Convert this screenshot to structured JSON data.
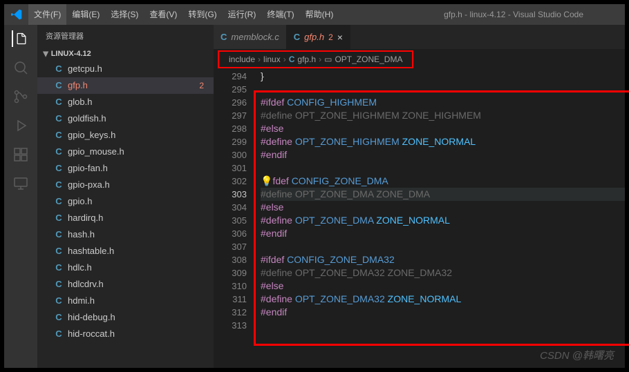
{
  "window": {
    "title": "gfp.h - linux-4.12 - Visual Studio Code"
  },
  "menu": [
    "文件(F)",
    "编辑(E)",
    "选择(S)",
    "查看(V)",
    "转到(G)",
    "运行(R)",
    "终端(T)",
    "帮助(H)"
  ],
  "sidebar": {
    "title": "资源管理器",
    "folder": "LINUX-4.12",
    "files": [
      {
        "lang": "C",
        "name": "getcpu.h"
      },
      {
        "lang": "C",
        "name": "gfp.h",
        "badge": "2",
        "selected": true
      },
      {
        "lang": "C",
        "name": "glob.h"
      },
      {
        "lang": "C",
        "name": "goldfish.h"
      },
      {
        "lang": "C",
        "name": "gpio_keys.h"
      },
      {
        "lang": "C",
        "name": "gpio_mouse.h"
      },
      {
        "lang": "C",
        "name": "gpio-fan.h"
      },
      {
        "lang": "C",
        "name": "gpio-pxa.h"
      },
      {
        "lang": "C",
        "name": "gpio.h"
      },
      {
        "lang": "C",
        "name": "hardirq.h"
      },
      {
        "lang": "C",
        "name": "hash.h"
      },
      {
        "lang": "C",
        "name": "hashtable.h"
      },
      {
        "lang": "C",
        "name": "hdlc.h"
      },
      {
        "lang": "C",
        "name": "hdlcdrv.h"
      },
      {
        "lang": "C",
        "name": "hdmi.h"
      },
      {
        "lang": "C",
        "name": "hid-debug.h"
      },
      {
        "lang": "C",
        "name": "hid-roccat.h"
      }
    ]
  },
  "tabs": [
    {
      "lang": "C",
      "name": "memblock.c",
      "active": false
    },
    {
      "lang": "C",
      "name": "gfp.h",
      "badge": "2",
      "active": true
    }
  ],
  "breadcrumb": {
    "parts": [
      "include",
      "linux"
    ],
    "fileLang": "C",
    "file": "gfp.h",
    "symbol": "OPT_ZONE_DMA"
  },
  "code": {
    "start": 294,
    "current": 303,
    "lines": [
      {
        "n": 294,
        "html": "<span class='tok-punc'>}</span>"
      },
      {
        "n": 295,
        "html": ""
      },
      {
        "n": 296,
        "html": "<span class='tok-dir'>#ifdef</span> <span class='tok-macro'>CONFIG_HIGHMEM</span>"
      },
      {
        "n": 297,
        "html": "<span class='tok-dim'>#define</span> <span class='tok-dim'>OPT_ZONE_HIGHMEM</span> <span class='tok-dim'>ZONE_HIGHMEM</span>"
      },
      {
        "n": 298,
        "html": "<span class='tok-dir'>#else</span>"
      },
      {
        "n": 299,
        "html": "<span class='tok-dir'>#define</span> <span class='tok-macro'>OPT_ZONE_HIGHMEM</span> <span class='tok-macro2'>ZONE_NORMAL</span>"
      },
      {
        "n": 300,
        "html": "<span class='tok-dir'>#endif</span>"
      },
      {
        "n": 301,
        "html": ""
      },
      {
        "n": 302,
        "html": "<span class='bulb'>💡</span><span class='tok-dir'>fdef</span> <span class='tok-macro'>CONFIG_ZONE_DMA</span>"
      },
      {
        "n": 303,
        "html": "<span class='tok-dim'>#define</span> <span class='tok-dim'>OPT_ZONE_DMA</span> <span class='tok-dim'>ZONE_DMA</span>",
        "hl": true
      },
      {
        "n": 304,
        "html": "<span class='tok-dir'>#else</span>"
      },
      {
        "n": 305,
        "html": "<span class='tok-dir'>#define</span> <span class='tok-macro'>OPT_ZONE_DMA</span> <span class='tok-macro2'>ZONE_NORMAL</span>"
      },
      {
        "n": 306,
        "html": "<span class='tok-dir'>#endif</span>"
      },
      {
        "n": 307,
        "html": ""
      },
      {
        "n": 308,
        "html": "<span class='tok-dir'>#ifdef</span> <span class='tok-macro'>CONFIG_ZONE_DMA32</span>"
      },
      {
        "n": 309,
        "html": "<span class='tok-dim'>#define</span> <span class='tok-dim'>OPT_ZONE_DMA32</span> <span class='tok-dim'>ZONE_DMA32</span>"
      },
      {
        "n": 310,
        "html": "<span class='tok-dir'>#else</span>"
      },
      {
        "n": 311,
        "html": "<span class='tok-dir'>#define</span> <span class='tok-macro'>OPT_ZONE_DMA32</span> <span class='tok-macro2'>ZONE_NORMAL</span>"
      },
      {
        "n": 312,
        "html": "<span class='tok-dir'>#endif</span>"
      },
      {
        "n": 313,
        "html": ""
      }
    ]
  },
  "watermark": "CSDN @韩曙亮"
}
